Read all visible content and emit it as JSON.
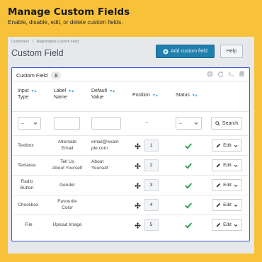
{
  "hero": {
    "title": "Manage Custom Fields",
    "subtitle": "Enable, disable, edit, or delete custom fields."
  },
  "breadcrumbs": [
    "Customers",
    "/",
    "Registration Custom Field"
  ],
  "page_title": "Custom Field",
  "toolbar": {
    "add_label": "Add custom field",
    "help_label": "Help"
  },
  "panel": {
    "title": "Custom Field",
    "count": "8"
  },
  "columns": {
    "input_type": [
      "Input",
      "Type"
    ],
    "label_name": [
      "Label",
      "Name"
    ],
    "default_value": [
      "Default",
      "Value"
    ],
    "position": "Position",
    "status": "Status"
  },
  "filters": {
    "input_type_select": "--",
    "position_dash": "--",
    "status_select": "--",
    "search_label": "Search"
  },
  "rows": [
    {
      "type": "Textbox",
      "label": [
        "Alternate",
        "Email"
      ],
      "default": [
        "email@exam",
        "ple.com"
      ],
      "position": "1",
      "edit": "Edit"
    },
    {
      "type": "Textarea",
      "label": [
        "Tell Us",
        "About Yourself"
      ],
      "default": [
        "About",
        "Yourself"
      ],
      "position": "2",
      "edit": "Edit"
    },
    {
      "type": [
        "Radio",
        "Button"
      ],
      "label": [
        "Gender"
      ],
      "default": [],
      "position": "3",
      "edit": "Edit"
    },
    {
      "type": "Checkbox",
      "label": [
        "Favourite",
        "Color"
      ],
      "default": [],
      "position": "4",
      "edit": "Edit"
    },
    {
      "type": "File",
      "label": [
        "Upload Image"
      ],
      "default": [],
      "position": "5",
      "edit": "Edit"
    }
  ],
  "colors": {
    "background": "#f7c239",
    "primary_button": "#1f7fad",
    "panel_border": "#3b58d6",
    "check": "#2e9e4f",
    "sort_arrows": "#3aa1d6"
  },
  "icons": [
    "plus-circle-icon",
    "add-circle-icon",
    "refresh-icon",
    "terminal-icon",
    "database-icon",
    "sort-arrows-icon",
    "search-icon",
    "move-icon",
    "check-icon",
    "chevron-down-icon"
  ]
}
